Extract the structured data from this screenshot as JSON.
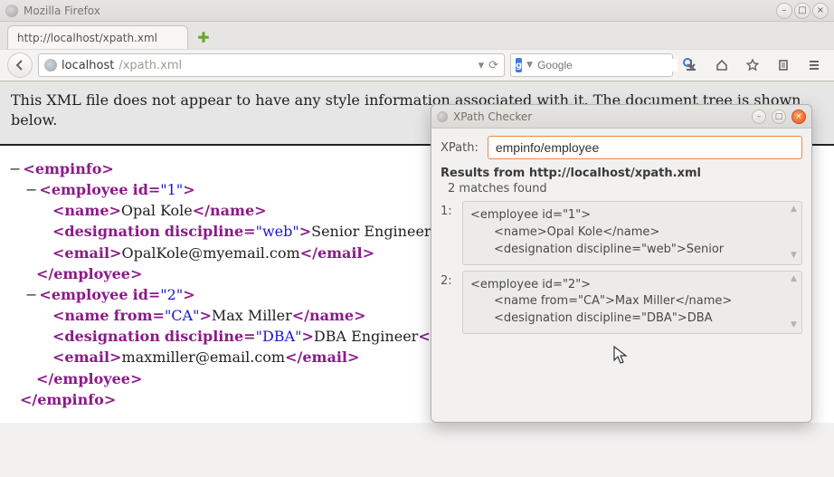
{
  "window": {
    "title": "Mozilla Firefox"
  },
  "tab": {
    "label": "http://localhost/xpath.xml"
  },
  "url": {
    "host": "localhost",
    "path": "/xpath.xml"
  },
  "search": {
    "placeholder": "Google",
    "engine_letter": "g"
  },
  "banner": {
    "text": "This XML file does not appear to have any style information associated with it. The document tree is shown below."
  },
  "xml": {
    "root": "empinfo",
    "employees": [
      {
        "id": "1",
        "name": {
          "text": "Opal Kole"
        },
        "designation": {
          "attr": "discipline",
          "attr_val": "web",
          "text": "Senior Engineer"
        },
        "email": "OpalKole@myemail.com"
      },
      {
        "id": "2",
        "name": {
          "from": "CA",
          "text": "Max Miller"
        },
        "designation": {
          "attr": "discipline",
          "attr_val": "DBA",
          "text": "DBA Engineer"
        },
        "email": "maxmiller@email.com"
      }
    ]
  },
  "dialog": {
    "title": "XPath Checker",
    "xpath_label": "XPath:",
    "xpath_value": "empinfo/employee",
    "results_header": "Results from http://localhost/xpath.xml",
    "matches_text": "2 matches found",
    "matches": [
      {
        "idx": "1:",
        "lines": [
          "<employee id=\"1\">",
          "<name>Opal Kole</name>",
          "<designation discipline=\"web\">Senior"
        ]
      },
      {
        "idx": "2:",
        "lines": [
          "<employee id=\"2\">",
          "<name from=\"CA\">Max Miller</name>",
          "<designation discipline=\"DBA\">DBA"
        ]
      }
    ]
  }
}
